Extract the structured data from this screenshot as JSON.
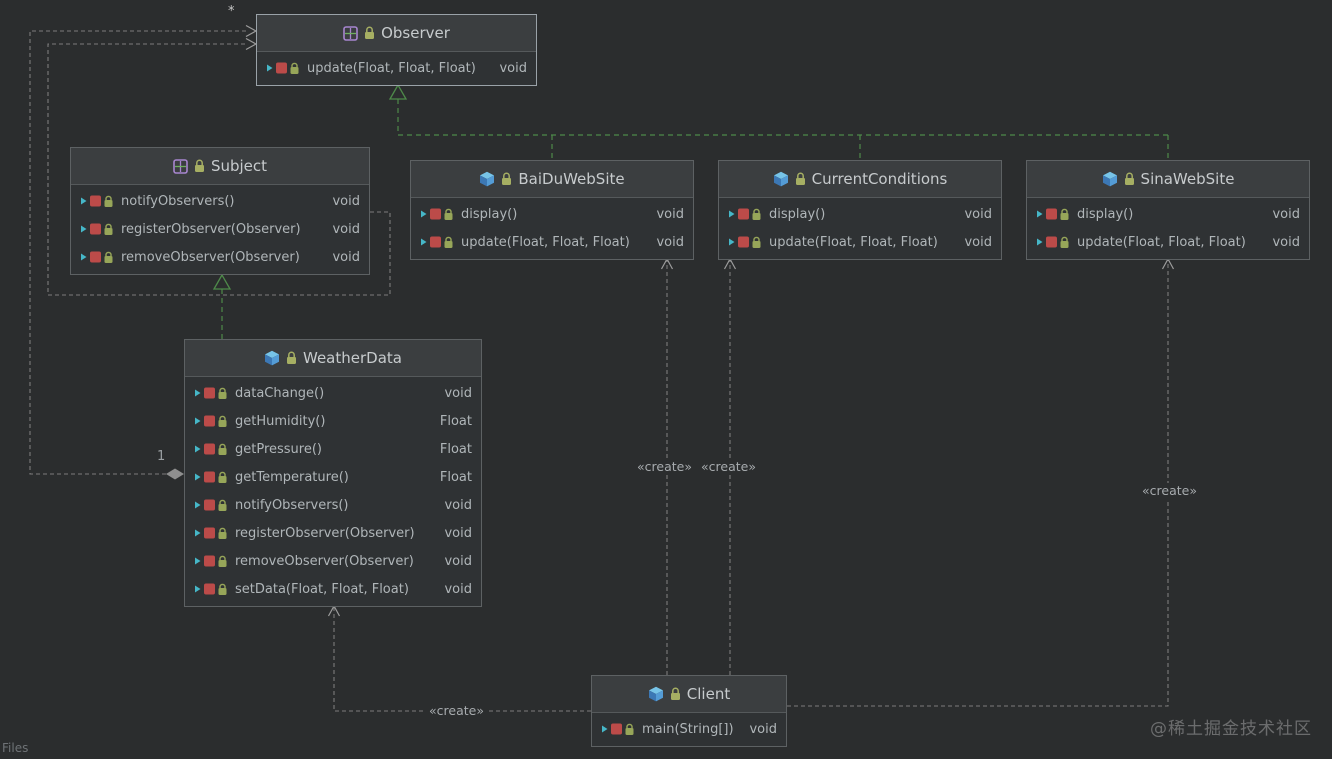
{
  "canvas": {
    "watermark": "@稀土掘金技术社区",
    "files_label": "Files"
  },
  "edge_labels": {
    "star": "*",
    "one": "1",
    "create": "«create»"
  },
  "classes": {
    "observer": {
      "kind": "interface",
      "name": "Observer",
      "methods": [
        {
          "sig": "update(Float, Float, Float)",
          "ret": "void"
        }
      ]
    },
    "subject": {
      "kind": "interface",
      "name": "Subject",
      "methods": [
        {
          "sig": "notifyObservers()",
          "ret": "void"
        },
        {
          "sig": "registerObserver(Observer)",
          "ret": "void"
        },
        {
          "sig": "removeObserver(Observer)",
          "ret": "void"
        }
      ]
    },
    "baidu": {
      "kind": "class",
      "name": "BaiDuWebSite",
      "methods": [
        {
          "sig": "display()",
          "ret": "void"
        },
        {
          "sig": "update(Float, Float, Float)",
          "ret": "void"
        }
      ]
    },
    "current": {
      "kind": "class",
      "name": "CurrentConditions",
      "methods": [
        {
          "sig": "display()",
          "ret": "void"
        },
        {
          "sig": "update(Float, Float, Float)",
          "ret": "void"
        }
      ]
    },
    "sina": {
      "kind": "class",
      "name": "SinaWebSite",
      "methods": [
        {
          "sig": "display()",
          "ret": "void"
        },
        {
          "sig": "update(Float, Float, Float)",
          "ret": "void"
        }
      ]
    },
    "weather": {
      "kind": "class",
      "name": "WeatherData",
      "methods": [
        {
          "sig": "dataChange()",
          "ret": "void"
        },
        {
          "sig": "getHumidity()",
          "ret": "Float"
        },
        {
          "sig": "getPressure()",
          "ret": "Float"
        },
        {
          "sig": "getTemperature()",
          "ret": "Float"
        },
        {
          "sig": "notifyObservers()",
          "ret": "void"
        },
        {
          "sig": "registerObserver(Observer)",
          "ret": "void"
        },
        {
          "sig": "removeObserver(Observer)",
          "ret": "void"
        },
        {
          "sig": "setData(Float, Float, Float)",
          "ret": "void"
        }
      ]
    },
    "client": {
      "kind": "class",
      "name": "Client",
      "methods": [
        {
          "sig": "main(String[])",
          "ret": "void"
        }
      ]
    }
  }
}
